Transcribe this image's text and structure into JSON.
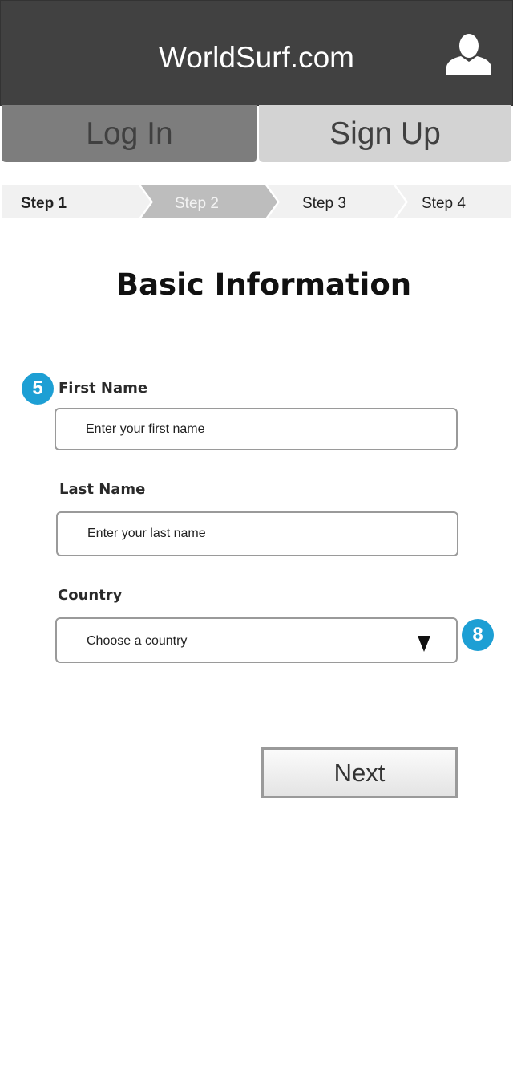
{
  "header": {
    "site_title": "WorldSurf.com",
    "user_icon": "user-icon"
  },
  "auth_tabs": {
    "login_label": "Log In",
    "signup_label": "Sign Up"
  },
  "steps": [
    {
      "label": "Step 1"
    },
    {
      "label": "Step 2"
    },
    {
      "label": "Step 3"
    },
    {
      "label": "Step 4"
    }
  ],
  "form": {
    "title": "Basic Information",
    "first_name": {
      "badge": "5",
      "label": "First Name",
      "placeholder": "Enter your first name"
    },
    "last_name": {
      "label": "Last Name",
      "placeholder": "Enter your last name"
    },
    "country": {
      "badge": "8",
      "label": "Country",
      "selected": "Choose a country",
      "icon": "chevron-down-icon"
    },
    "next_label": "Next"
  },
  "colors": {
    "header_bg": "#414141",
    "login_tab_bg": "#7d7d7d",
    "signup_tab_bg": "#d3d3d3",
    "current_step_bg": "#bdbdbd",
    "badge_bg": "#1d9fd4"
  }
}
